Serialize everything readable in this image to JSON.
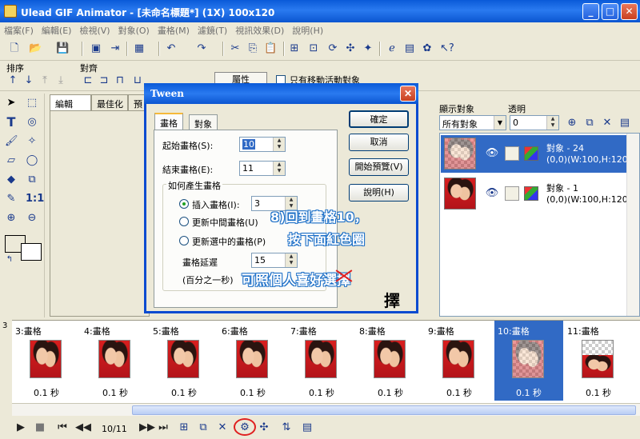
{
  "window": {
    "title": "Ulead GIF Animator - [未命名標題*] (1X) 100x120",
    "controls": {
      "minimize": "_",
      "maximize": "□",
      "close": "✕"
    }
  },
  "menu": [
    "檔案(F)",
    "編輯(E)",
    "檢視(V)",
    "對象(O)",
    "畫格(M)",
    "濾鏡(T)",
    "視訊效果(D)",
    "說明(H)"
  ],
  "toolbar2": {
    "sort_label": "排序",
    "align_label": "對齊",
    "properties_label": "屬性",
    "only_moving_label": "只有移動活動對象"
  },
  "editor_tabs": [
    "編輯",
    "最佳化",
    "預"
  ],
  "object_panel": {
    "show_label": "顯示對象",
    "transparency_label": "透明",
    "filter_value": "所有對象",
    "transparency_value": "0",
    "objects": [
      {
        "name": "對象 - 24",
        "info": "(0,0)(W:100,H:120)",
        "selected": true
      },
      {
        "name": "對象 - 1",
        "info": "(0,0)(W:100,H:120)",
        "selected": false
      }
    ]
  },
  "frames": [
    {
      "label": "3:畫格",
      "delay": "0.1 秒"
    },
    {
      "label": "4:畫格",
      "delay": "0.1 秒"
    },
    {
      "label": "5:畫格",
      "delay": "0.1 秒"
    },
    {
      "label": "6:畫格",
      "delay": "0.1 秒"
    },
    {
      "label": "7:畫格",
      "delay": "0.1 秒"
    },
    {
      "label": "8:畫格",
      "delay": "0.1 秒"
    },
    {
      "label": "9:畫格",
      "delay": "0.1 秒"
    },
    {
      "label": "10:畫格",
      "delay": "0.1 秒"
    },
    {
      "label": "11:畫格",
      "delay": "0.1 秒"
    }
  ],
  "frames_strip_marker": "3",
  "playback": {
    "frame_counter": "10/11"
  },
  "tween_dialog": {
    "title": "Tween",
    "tabs": [
      "畫格",
      "對象"
    ],
    "start_frame_label": "起始畫格(S):",
    "start_frame_value": "10",
    "end_frame_label": "結束畫格(E):",
    "end_frame_value": "11",
    "group_label": "如何產生畫格",
    "insert_label": "插入畫格(I):",
    "insert_value": "3",
    "update_middle_label": "更新中間畫格(U)",
    "update_selected_label": "更新選中的畫格(P)",
    "delay_label": "畫格延遲",
    "delay_value": "15",
    "delay_unit_label": "(百分之一秒)",
    "buttons": {
      "ok": "確定",
      "cancel": "取消",
      "preview": "開始預覽(V)",
      "help": "說明(H)"
    }
  },
  "annotation": {
    "line1": "8)回到畫格10，",
    "line2": "按下面紅色圈",
    "line3_prefix": "可照個人喜好選",
    "line3_struck": "擇",
    "correction": "擇"
  },
  "colors": {
    "titlebar": "#0a5ad8",
    "selection": "#316ac5",
    "annotation": "#1c6fc7",
    "circle": "#e02020"
  }
}
